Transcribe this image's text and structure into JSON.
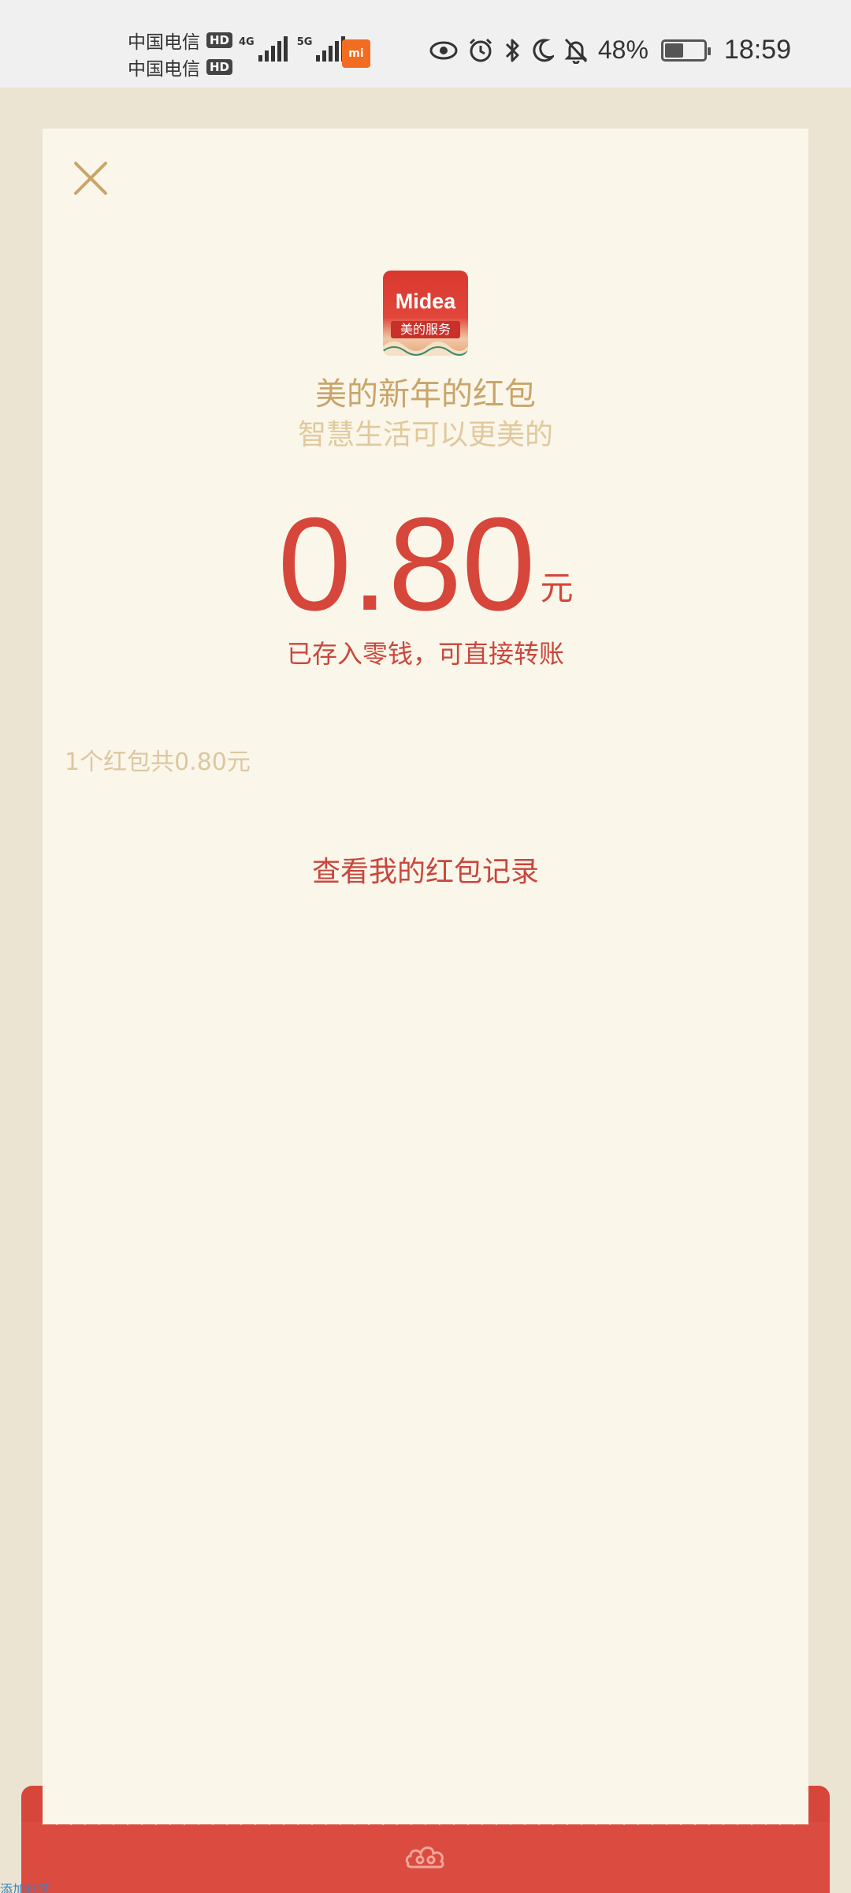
{
  "status_bar": {
    "carrier_1": "中国电信",
    "carrier_2": "中国电信",
    "hd_label": "HD",
    "net_4g": "4G",
    "net_5g": "5G",
    "mi_label": "mi",
    "battery_percent": "48%",
    "battery_level": 0.48,
    "time": "18:59",
    "icons": [
      "eye-icon",
      "alarm-icon",
      "bluetooth-icon",
      "moon-icon",
      "bell-off-icon",
      "battery-icon"
    ]
  },
  "card": {
    "logo": {
      "wordmark": "Midea",
      "caption": "美的服务"
    },
    "title": "美的新年的红包",
    "subtitle": "智慧生活可以更美的",
    "amount": "0.80",
    "currency": "元",
    "notice": "已存入零钱，可直接转账",
    "summary": "1个红包共0.80元",
    "records_link": "查看我的红包记录"
  },
  "watermark": "添加社区",
  "colors": {
    "accent_red": "#d6463a",
    "gold": "#c9a56a",
    "card_bg": "#faf6ea",
    "page_bg": "#ece4d2"
  }
}
